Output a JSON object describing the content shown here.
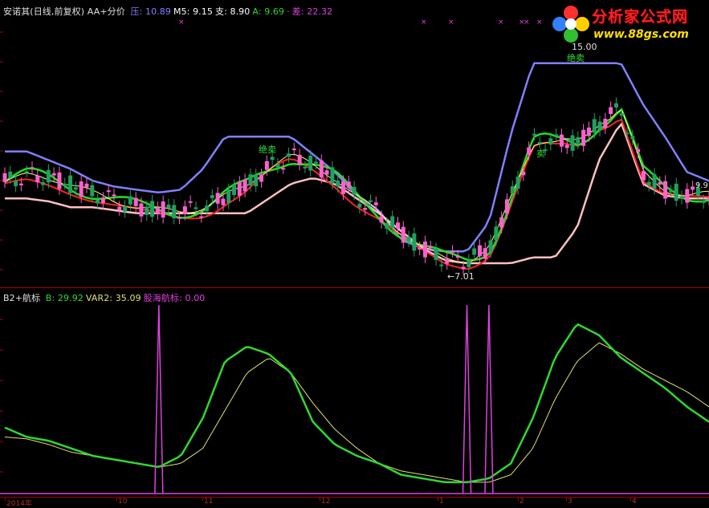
{
  "colors": {
    "background": "#000000",
    "resistance": "#8080ff",
    "support": "#ffc0c0",
    "ma5": "#ffff80",
    "ma_red": "#ff2020",
    "ma_green": "#20e020",
    "candle_up": "#ff60d0",
    "candle_down": "#20a060",
    "osc_b": "#30d830",
    "osc_var2": "#e0e070",
    "osc_magenta": "#e040e0",
    "axis": "#b00000"
  },
  "price_panel": {
    "title": "安诺其(日线,前复权)",
    "indicator": "AA+分价",
    "legend": [
      {
        "label": "压:",
        "value": "10.89",
        "color": "#8080ff"
      },
      {
        "label": "M5:",
        "value": "9.15",
        "color": "#ffffff"
      },
      {
        "label": "支:",
        "value": "8.90",
        "color": "#ffffff"
      },
      {
        "label": "A:",
        "value": "9.69",
        "color": "#30d830"
      },
      {
        "label": "·",
        "value": "",
        "color": "#e040e0"
      },
      {
        "label": "差:",
        "value": "22.32",
        "color": "#e040e0"
      }
    ],
    "annotations": {
      "sell_1": "绝卖",
      "sell_2": "绝卖",
      "buy_1": "卖",
      "high_label": "15.00",
      "low_label": "←7.01",
      "right_label": "9.9"
    }
  },
  "osc_panel": {
    "title": "B2+航标",
    "legend": [
      {
        "label": "B:",
        "value": "29.92",
        "color": "#30d830"
      },
      {
        "label": "VAR2:",
        "value": "35.09",
        "color": "#e0e070"
      },
      {
        "label": "股海航标:",
        "value": "0.00",
        "color": "#e040e0"
      }
    ]
  },
  "time_axis": {
    "labels": [
      "2014年",
      "10",
      "11",
      "12",
      "1",
      "2",
      "3",
      "4"
    ]
  },
  "logo": {
    "title": "分析家公式网",
    "url": "www.88gs.com"
  },
  "chart_data": {
    "type": "line",
    "symbol": "安诺其",
    "price_range": [
      6.5,
      15.5
    ],
    "resistance": [
      10.9,
      10.9,
      10.6,
      10.3,
      9.9,
      9.7,
      9.6,
      9.5,
      9.6,
      10.3,
      11.4,
      11.4,
      11.4,
      11.4,
      10.8,
      10.2,
      9.4,
      8.9,
      7.9,
      7.6,
      7.5,
      7.5,
      8.5,
      11.5,
      13.9,
      13.9,
      13.9,
      13.9,
      13.9,
      12.5,
      11.4,
      10.2,
      9.9
    ],
    "support": [
      9.3,
      9.3,
      9.2,
      9.0,
      9.0,
      8.9,
      8.8,
      8.8,
      8.8,
      8.8,
      8.8,
      8.8,
      9.3,
      9.8,
      10.0,
      9.8,
      9.3,
      8.8,
      8.2,
      7.6,
      7.2,
      7.1,
      7.1,
      7.1,
      7.3,
      7.3,
      8.3,
      10.6,
      11.9,
      9.8,
      9.4,
      9.3,
      9.3
    ],
    "osc_b": [
      35,
      30,
      28,
      24,
      20,
      18,
      16,
      14,
      20,
      40,
      70,
      78,
      74,
      64,
      38,
      26,
      20,
      16,
      10,
      8,
      6,
      6,
      8,
      16,
      40,
      72,
      90,
      84,
      72,
      64,
      56,
      46,
      38
    ],
    "osc_var2": [
      30,
      29,
      26,
      22,
      20,
      18,
      16,
      14,
      16,
      24,
      44,
      64,
      72,
      64,
      48,
      34,
      24,
      16,
      12,
      10,
      8,
      6,
      6,
      10,
      24,
      50,
      70,
      80,
      74,
      66,
      60,
      54,
      46
    ],
    "osc_signal": [
      0,
      0,
      0,
      0,
      0,
      0,
      0,
      100,
      0,
      0,
      0,
      0,
      0,
      0,
      0,
      0,
      0,
      0,
      0,
      0,
      0,
      100,
      100,
      0,
      0,
      0,
      0,
      0,
      0,
      0,
      0,
      0,
      0
    ]
  }
}
